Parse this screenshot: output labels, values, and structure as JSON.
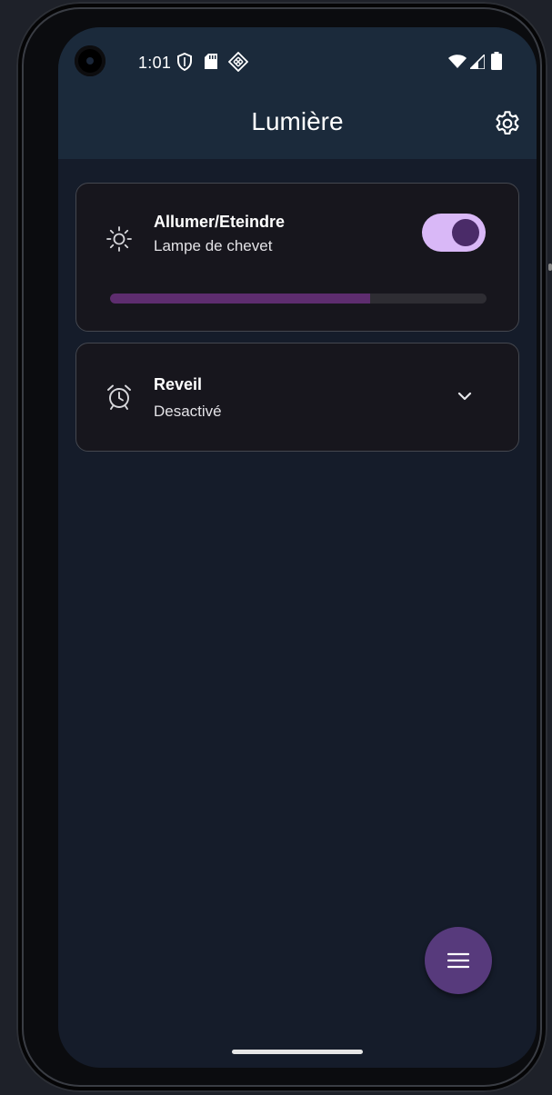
{
  "status_bar": {
    "time": "1:01",
    "left_icons": [
      "shield-icon",
      "sd-card-icon",
      "diamond-grid-icon"
    ],
    "right_icons": [
      "wifi-icon",
      "cell-signal-icon",
      "battery-icon"
    ]
  },
  "app_bar": {
    "title": "Lumière",
    "action_icon": "gear-icon"
  },
  "cards": {
    "power": {
      "icon": "brightness-icon",
      "title": "Allumer/Eteindre",
      "subtitle": "Lampe de chevet",
      "toggle_on": true,
      "brightness_fraction": 0.69
    },
    "alarm": {
      "icon": "alarm-clock-icon",
      "title": "Reveil",
      "subtitle": "Desactivé",
      "expand_icon": "chevron-down-icon"
    }
  },
  "fab": {
    "icon": "menu-icon"
  },
  "colors": {
    "background": "#151c2a",
    "app_bar": "#1b2a3b",
    "card": "#17161d",
    "toggle_track": "#d9b8f7",
    "toggle_thumb": "#4a2b68",
    "slider_fill": "#5e2d6f",
    "fab": "#573a7c"
  }
}
